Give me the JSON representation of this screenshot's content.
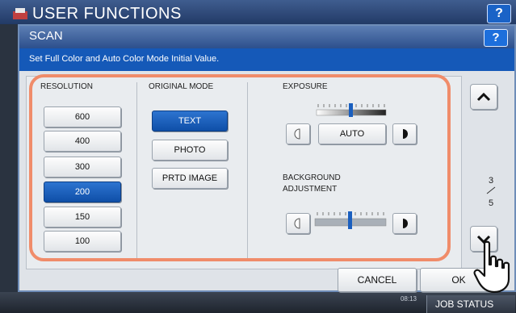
{
  "background": {
    "title": "USER FUNCTIONS",
    "help_label": "?",
    "time_date": "",
    "time_clock": "08:13",
    "job_status_label": "JOB STATUS"
  },
  "dialog": {
    "title": "SCAN",
    "help_label": "?",
    "message": "Set Full Color and Auto Color Mode Initial Value."
  },
  "resolution": {
    "label": "RESOLUTION",
    "options": [
      "600",
      "400",
      "300",
      "200",
      "150",
      "100"
    ],
    "selected": "200"
  },
  "original_mode": {
    "label": "ORIGINAL MODE",
    "options": [
      "TEXT",
      "PHOTO",
      "PRTD IMAGE"
    ],
    "selected": "TEXT"
  },
  "exposure": {
    "label": "EXPOSURE",
    "auto_label": "AUTO",
    "level": 0
  },
  "background_adjustment": {
    "label_line1": "BACKGROUND",
    "label_line2": "ADJUSTMENT",
    "level": 0
  },
  "pager": {
    "current": "3",
    "total": "5"
  },
  "buttons": {
    "cancel_label": "CANCEL",
    "ok_label": "OK"
  },
  "colors": {
    "accent": "#1559b8",
    "selected": "#1a5fbf",
    "highlight": "#f08c6a"
  }
}
